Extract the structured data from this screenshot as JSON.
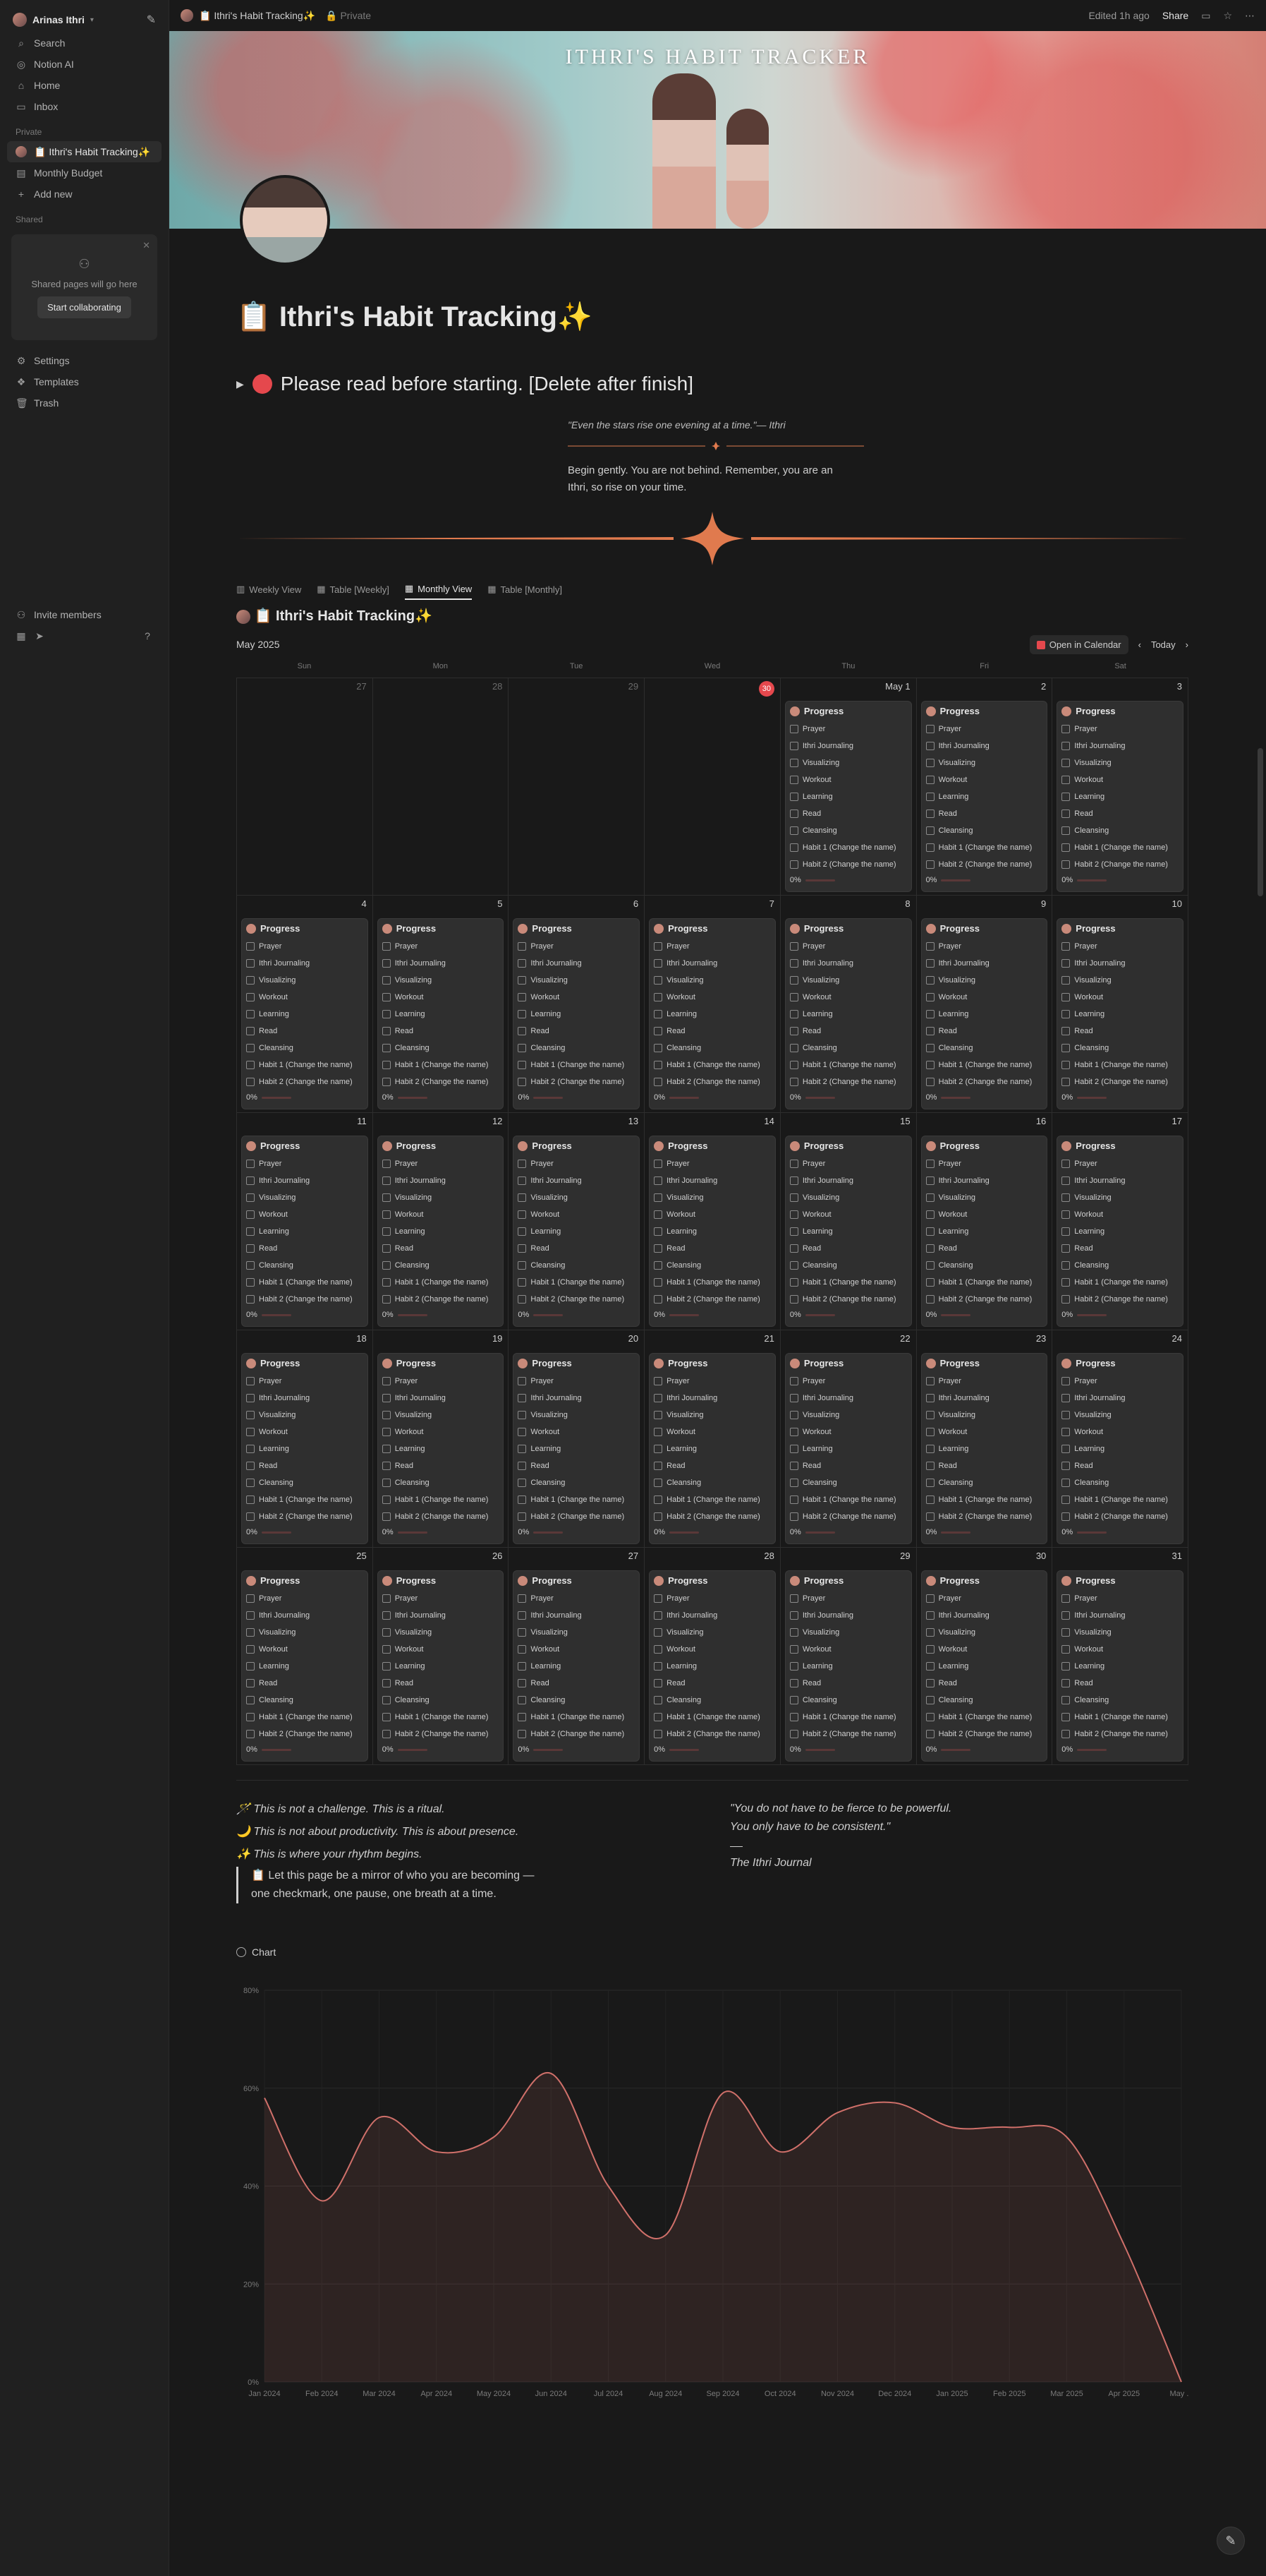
{
  "sidebar": {
    "workspace": "Arinas Ithri",
    "top": [
      "Search",
      "Notion AI",
      "Home",
      "Inbox"
    ],
    "private_label": "Private",
    "private_items": [
      "📋 Ithri's Habit Tracking✨",
      "Monthly Budget",
      "Add new"
    ],
    "shared_label": "Shared",
    "collab_text": "Shared pages will go here",
    "collab_btn": "Start collaborating",
    "bottom": [
      "Settings",
      "Templates",
      "Trash"
    ],
    "invite": "Invite members"
  },
  "topbar": {
    "crumb": "📋 Ithri's Habit Tracking✨",
    "private": "🔒 Private",
    "edited": "Edited 1h ago",
    "share": "Share"
  },
  "cover_title": "ITHRI'S HABIT TRACKER",
  "page": {
    "title": "📋 Ithri's Habit Tracking✨",
    "toggle": "Please read before starting. [Delete after finish]",
    "quote1": "\"Even the stars rise one evening at a time.\"— Ithri",
    "begin": "Begin gently. You are not behind. Remember, you are an Ithri, so rise on your time."
  },
  "tabs": [
    "Weekly View",
    "Table [Weekly]",
    "Monthly View",
    "Table [Monthly]"
  ],
  "db_title": "📋 Ithri's Habit Tracking✨",
  "calendar": {
    "month": "May 2025",
    "open": "Open in Calendar",
    "today": "Today",
    "dow": [
      "Sun",
      "Mon",
      "Tue",
      "Wed",
      "Thu",
      "Fri",
      "Sat"
    ],
    "card_title": "Progress",
    "habits": [
      "Prayer",
      "Ithri Journaling",
      "Visualizing",
      "Workout",
      "Learning",
      "Read",
      "Cleansing",
      "Habit 1 (Change the name)",
      "Habit 2 (Change the name)"
    ],
    "progress": "0%",
    "days": [
      "27",
      "28",
      "29",
      "30",
      "May 1",
      "2",
      "3",
      "4",
      "5",
      "6",
      "7",
      "8",
      "9",
      "10",
      "11",
      "12",
      "13",
      "14",
      "15",
      "16",
      "17",
      "18",
      "19",
      "20",
      "21",
      "22",
      "23",
      "24",
      "25",
      "26",
      "27",
      "28",
      "29",
      "30",
      "31"
    ]
  },
  "ritual": [
    "🪄 This is not a challenge. This is a ritual.",
    "🌙 This is not about productivity. This is about presence.",
    "✨ This is where your rhythm begins."
  ],
  "callout": "📋 Let this page be a mirror of who you are becoming — one checkmark, one pause, one breath at a time.",
  "right_quote": {
    "line1": "\"You do not have to be fierce to be powerful.",
    "line2": "You only have to be consistent.\"",
    "sig": "The Ithri Journal"
  },
  "chart_label": "Chart",
  "chart_data": {
    "type": "area",
    "x": [
      "Jan 2024",
      "Feb 2024",
      "Mar 2024",
      "Apr 2024",
      "May 2024",
      "Jun 2024",
      "Jul 2024",
      "Aug 2024",
      "Sep 2024",
      "Oct 2024",
      "Nov 2024",
      "Dec 2024",
      "Jan 2025",
      "Feb 2025",
      "Mar 2025",
      "Apr 2025",
      "May ..."
    ],
    "values": [
      58,
      37,
      54,
      47,
      50,
      63,
      40,
      30,
      59,
      47,
      55,
      57,
      52,
      52,
      50,
      28,
      0
    ],
    "ylim": [
      0,
      80
    ],
    "yticks": [
      "0%",
      "20%",
      "40%",
      "60%",
      "80%"
    ],
    "color": "#d0706a",
    "grid": true
  }
}
